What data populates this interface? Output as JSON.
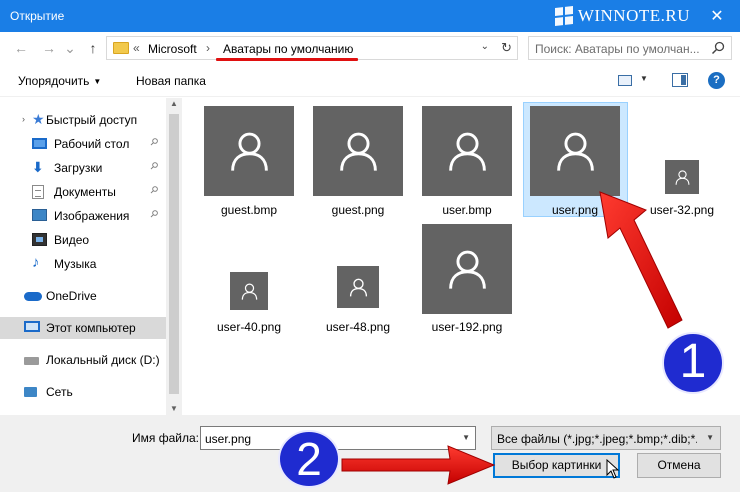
{
  "window": {
    "title": "Открытие",
    "close_glyph": "✕"
  },
  "watermark": {
    "text": "WINNOTE.RU"
  },
  "nav": {
    "back_glyph": "←",
    "forward_glyph": "→",
    "recent_glyph": "⌄",
    "up_glyph": "↑",
    "breadcrumb_sep0": "«",
    "crumb1": "Microsoft",
    "breadcrumb_sep1": "›",
    "crumb2": "Аватары по умолчанию",
    "dropdown_glyph": "⌄",
    "refresh_glyph": "↻"
  },
  "search": {
    "placeholder": "Поиск: Аватары по умолчан..."
  },
  "toolbar": {
    "organize": "Упорядочить",
    "organize_arrow": "▼",
    "new_folder": "Новая папка",
    "view_arrow": "▼",
    "help": "?"
  },
  "sidebar": {
    "items": [
      {
        "label": "Быстрый доступ",
        "icon": "star-icon"
      },
      {
        "label": "Рабочий стол",
        "icon": "desktop-icon",
        "pinned": true
      },
      {
        "label": "Загрузки",
        "icon": "downloads-icon",
        "pinned": true
      },
      {
        "label": "Документы",
        "icon": "documents-icon",
        "pinned": true
      },
      {
        "label": "Изображения",
        "icon": "pictures-icon",
        "pinned": true
      },
      {
        "label": "Видео",
        "icon": "video-icon"
      },
      {
        "label": "Музыка",
        "icon": "music-icon"
      },
      {
        "label": "OneDrive",
        "icon": "onedrive-icon"
      },
      {
        "label": "Этот компьютер",
        "icon": "this-pc-icon",
        "selected": true
      },
      {
        "label": "Локальный диск (D:)",
        "icon": "drive-icon"
      },
      {
        "label": "Сеть",
        "icon": "network-icon"
      }
    ],
    "caret": "›",
    "pin_glyph": "📌"
  },
  "files": [
    {
      "name": "guest.bmp"
    },
    {
      "name": "guest.png"
    },
    {
      "name": "user.bmp"
    },
    {
      "name": "user.png",
      "selected": true
    },
    {
      "name": "user-32.png"
    },
    {
      "name": "user-40.png"
    },
    {
      "name": "user-48.png"
    },
    {
      "name": "user-192.png"
    }
  ],
  "annotations": {
    "badge1": "1",
    "badge2": "2"
  },
  "bottom": {
    "filename_label": "Имя файла:",
    "filename_value": "user.png",
    "filter_value": "Все файлы (*.jpg;*.jpeg;*.bmp;*.dib;*.p",
    "dropdown_glyph": "▼",
    "select_button": "Выбор картинки",
    "cancel_button": "Отмена"
  },
  "colors": {
    "titlebar": "#1a7ee6",
    "thumb": "#636363",
    "selection": "#cce8ff",
    "annotation_red": "#e01010",
    "badge_blue": "#1f2bd0"
  }
}
